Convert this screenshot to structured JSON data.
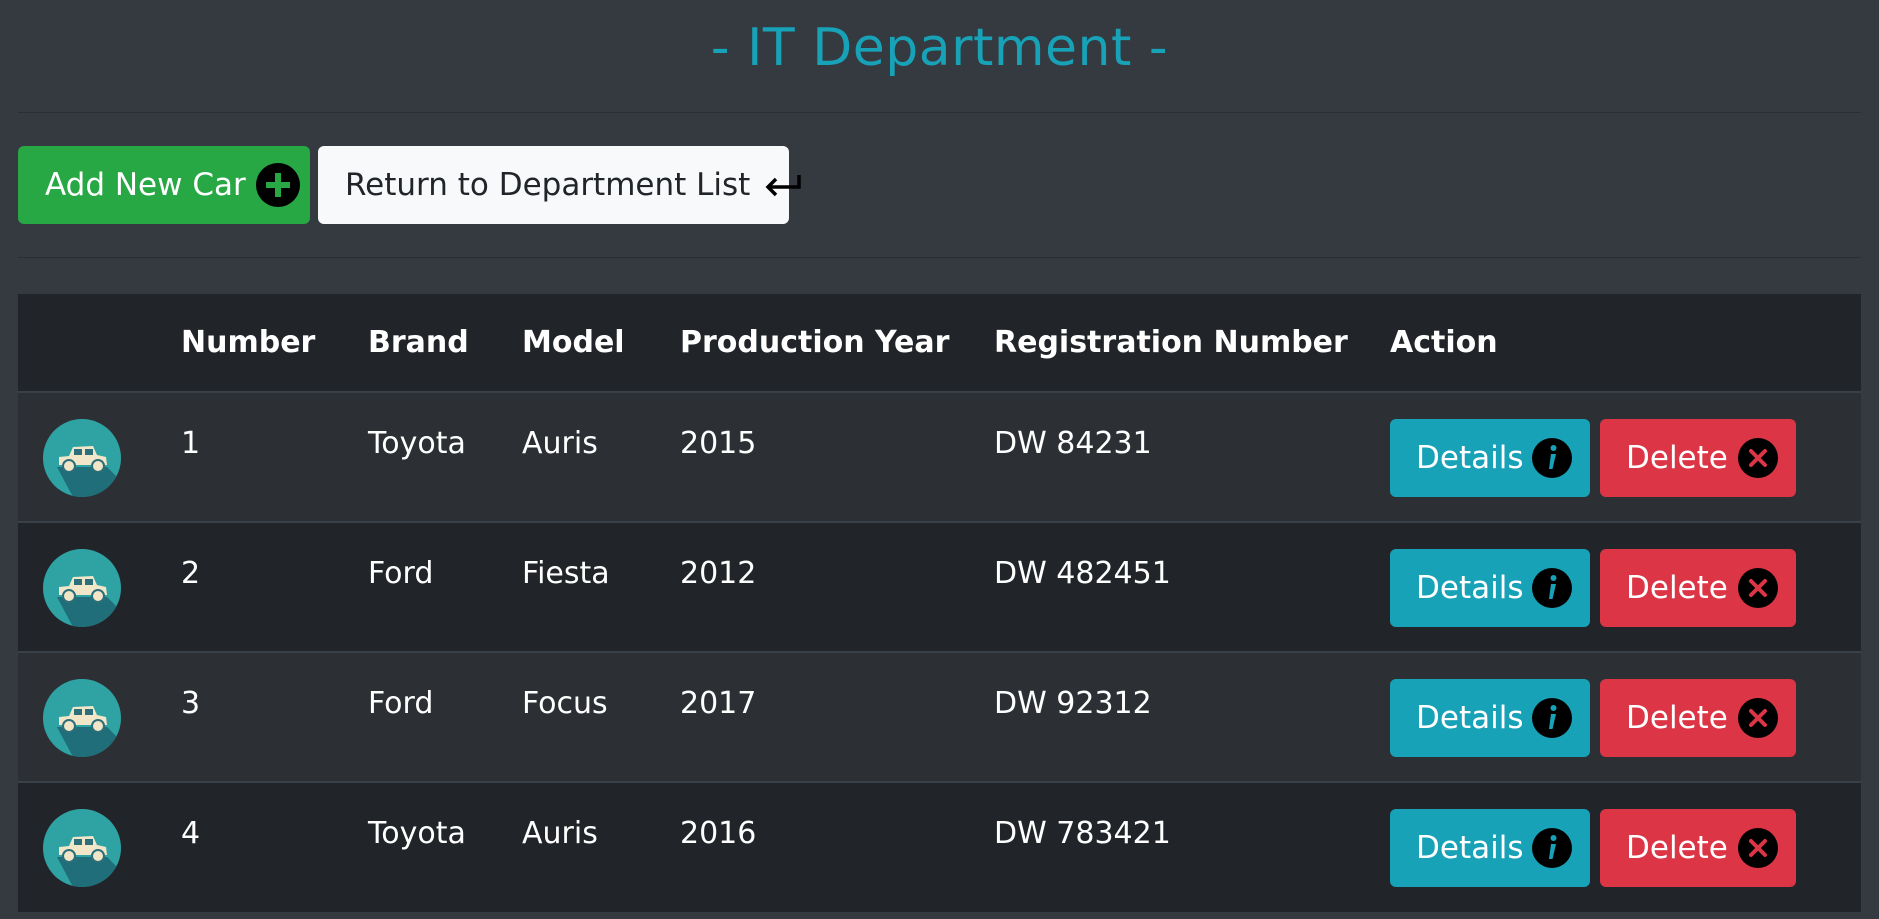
{
  "header": {
    "title": "- IT Department -"
  },
  "toolbar": {
    "add_label": "Add New Car",
    "return_label": "Return to Department List"
  },
  "table": {
    "columns": [
      "",
      "Number",
      "Brand",
      "Model",
      "Production Year",
      "Registration Number",
      "Action"
    ],
    "rows": [
      {
        "number": "1",
        "brand": "Toyota",
        "model": "Auris",
        "year": "2015",
        "registration": "DW 84231"
      },
      {
        "number": "2",
        "brand": "Ford",
        "model": "Fiesta",
        "year": "2012",
        "registration": "DW 482451"
      },
      {
        "number": "3",
        "brand": "Ford",
        "model": "Focus",
        "year": "2017",
        "registration": "DW 92312"
      },
      {
        "number": "4",
        "brand": "Toyota",
        "model": "Auris",
        "year": "2016",
        "registration": "DW 783421"
      }
    ],
    "actions": {
      "details_label": "Details",
      "delete_label": "Delete"
    }
  },
  "icons": {
    "add": "plus-circle-icon",
    "return": "return-arrow-icon",
    "details": "info-circle-icon",
    "delete": "x-circle-icon",
    "car": "vintage-car-icon"
  },
  "colors": {
    "background": "#343a40",
    "accent": "#17a2b8",
    "success": "#28a745",
    "danger": "#dc3545",
    "light": "#f8f9fa",
    "table_header": "#212529"
  }
}
